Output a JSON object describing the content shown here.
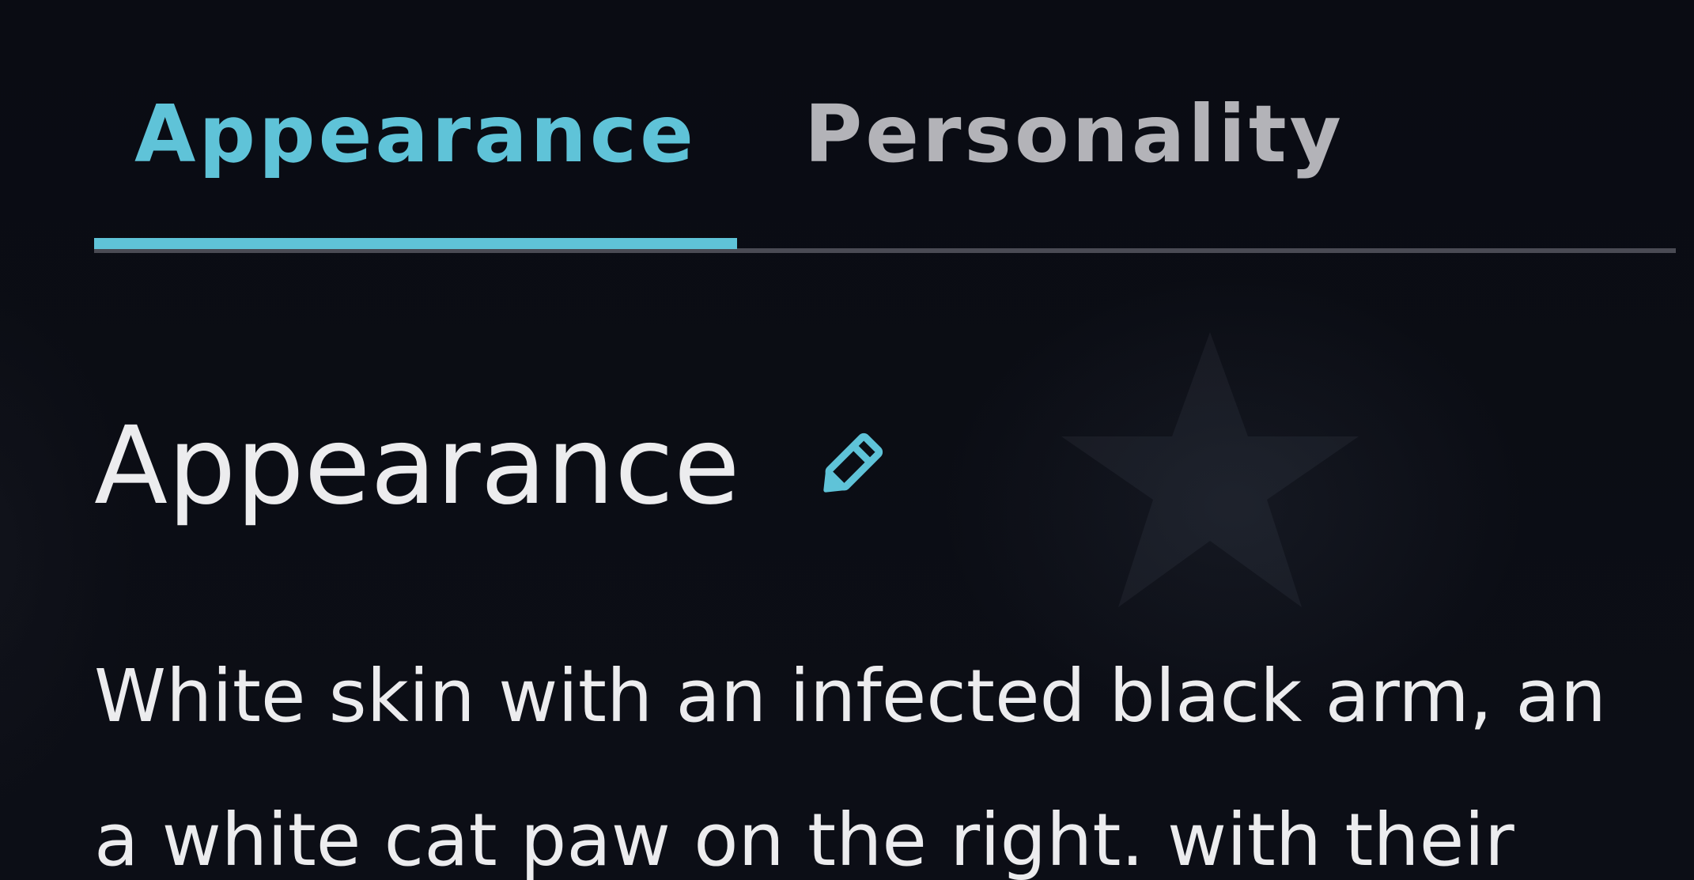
{
  "tabs": [
    {
      "label": "Appearance",
      "active": true
    },
    {
      "label": "Personality",
      "active": false
    }
  ],
  "section": {
    "title": "Appearance",
    "edit_icon": "pencil-icon"
  },
  "description": {
    "line_1": "White skin with an infected black arm, an",
    "line_2": "a white cat paw on the right. with their"
  },
  "colors": {
    "accent": "#5fc3d8",
    "inactive_tab": "#b3b3b8",
    "background": "#0b0d14",
    "text": "#ececee",
    "track": "#4a4b54"
  }
}
